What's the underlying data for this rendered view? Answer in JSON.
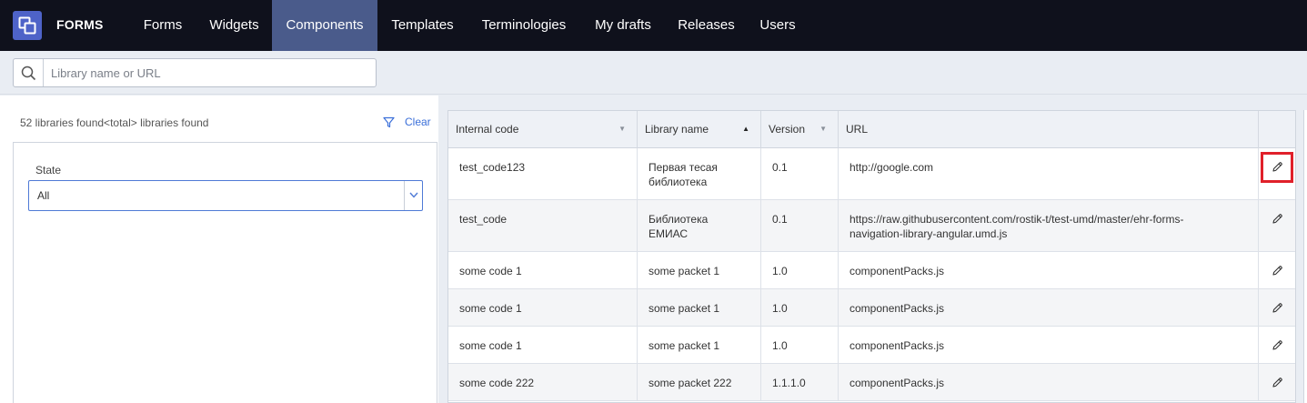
{
  "app": {
    "brand": "FORMS",
    "nav": [
      {
        "label": "Forms",
        "active": false
      },
      {
        "label": "Widgets",
        "active": false
      },
      {
        "label": "Components",
        "active": true
      },
      {
        "label": "Templates",
        "active": false
      },
      {
        "label": "Terminologies",
        "active": false
      },
      {
        "label": "My drafts",
        "active": false
      },
      {
        "label": "Releases",
        "active": false
      },
      {
        "label": "Users",
        "active": false
      }
    ]
  },
  "search": {
    "placeholder": "Library name or URL",
    "value": ""
  },
  "filters": {
    "found_text": "52 libraries found<total> libraries found",
    "clear_label": "Clear",
    "state_label": "State",
    "state_value": "All"
  },
  "table": {
    "columns": [
      {
        "label": "Internal code",
        "sort": "none"
      },
      {
        "label": "Library name",
        "sort": "asc"
      },
      {
        "label": "Version",
        "sort": "none"
      },
      {
        "label": "URL",
        "sort": "none"
      }
    ],
    "rows": [
      {
        "code": "test_code123",
        "name": [
          "Первая тесая",
          "библиотека"
        ],
        "version": "0.1",
        "url": [
          "http://google.com"
        ]
      },
      {
        "code": "test_code",
        "name": [
          "Библиотека",
          "ЕМИАС"
        ],
        "version": "0.1",
        "url": [
          "https://raw.githubusercontent.com/rostik-t/test-umd/master/ehr-forms-",
          "navigation-library-angular.umd.js"
        ]
      },
      {
        "code": "some code 1",
        "name": [
          "some packet 1"
        ],
        "version": "1.0",
        "url": [
          "componentPacks.js"
        ]
      },
      {
        "code": "some code 1",
        "name": [
          "some packet 1"
        ],
        "version": "1.0",
        "url": [
          "componentPacks.js"
        ]
      },
      {
        "code": "some code 1",
        "name": [
          "some packet 1"
        ],
        "version": "1.0",
        "url": [
          "componentPacks.js"
        ]
      },
      {
        "code": "some code 222",
        "name": [
          "some packet 222"
        ],
        "version": "1.1.1.0",
        "url": [
          "componentPacks.js"
        ]
      }
    ]
  },
  "colors": {
    "accent": "#4e63c8",
    "nav_bg": "#0f111c",
    "active_tab": "#4a5b8b",
    "highlight": "#e0202a",
    "link": "#3b6fd9"
  },
  "icons": {
    "logo": "copy-squares-icon",
    "search": "search-icon",
    "filter": "filter-icon",
    "dropdown": "chevron-down-icon",
    "edit": "pencil-icon",
    "sort": "triangle-icon"
  }
}
